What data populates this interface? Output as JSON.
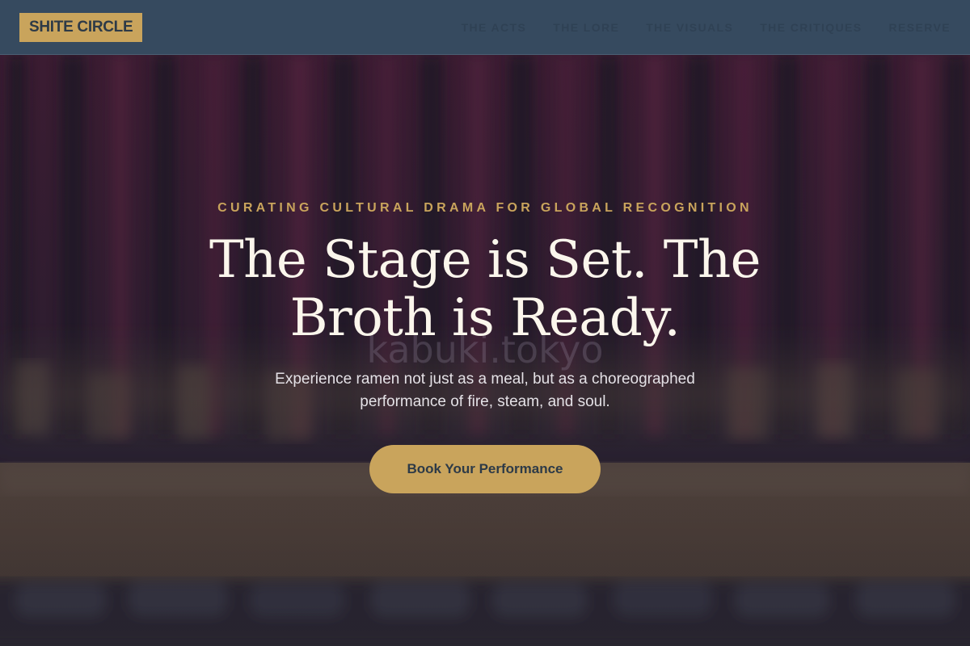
{
  "navbar": {
    "logo_text": "SHITE CIRCLE",
    "links": [
      {
        "label": "THE ACTS"
      },
      {
        "label": "THE LORE"
      },
      {
        "label": "THE VISUALS"
      },
      {
        "label": "THE CRITIQUES"
      },
      {
        "label": "RESERVE"
      }
    ]
  },
  "hero": {
    "eyebrow": "CURATING CULTURAL DRAMA FOR GLOBAL RECOGNITION",
    "headline": "The Stage is Set. The Broth is Ready.",
    "watermark": "kabuki.tokyo",
    "subtitle": "Experience ramen not just as a meal, but as a choreographed performance of fire, steam, and soul.",
    "cta_label": "Book Your Performance",
    "background_image": "blurred-theater-stage-curtain"
  },
  "colors": {
    "nav_background": "#364a5f",
    "accent_gold": "#c9a45c",
    "headline_text": "#fbf6ec",
    "curtain_crimson": "#5a1f3a",
    "dark_text": "#2d3a47"
  }
}
